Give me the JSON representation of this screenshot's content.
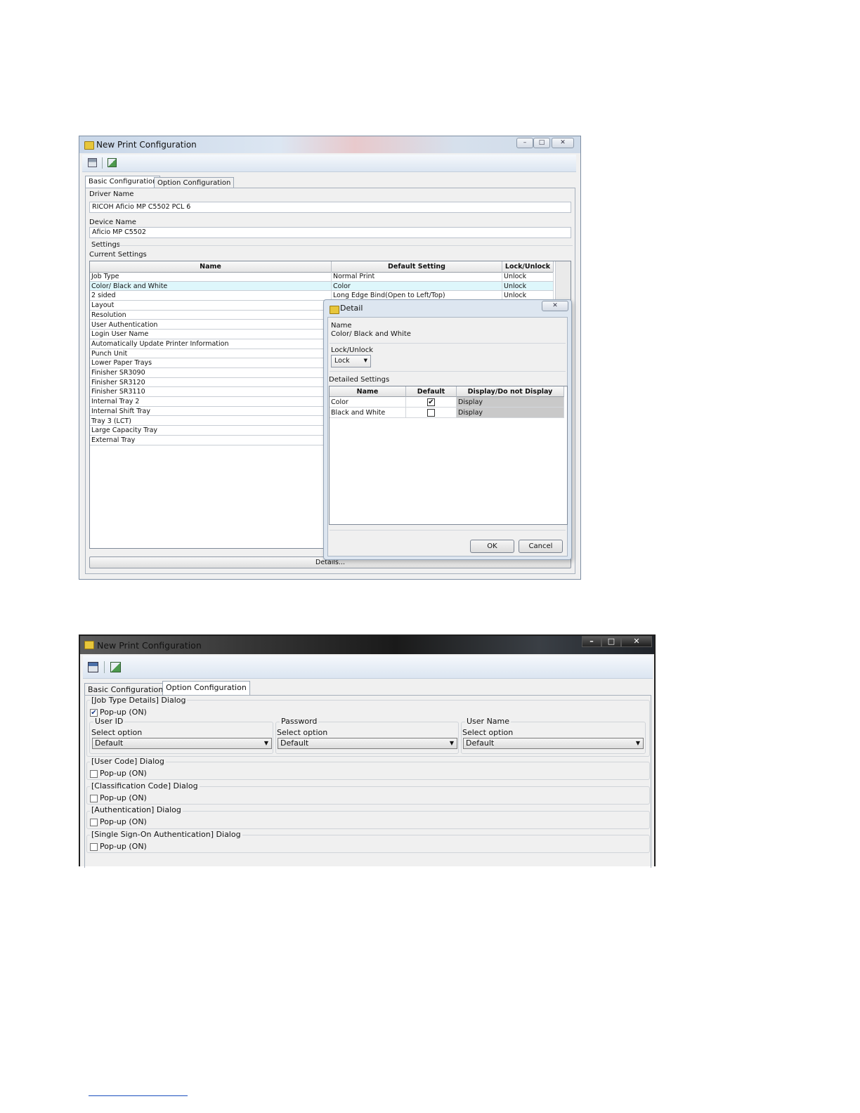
{
  "window1": {
    "title": "New Print Configuration",
    "toolbar_icons": [
      "save-icon",
      "export-icon"
    ],
    "tabs": [
      "Basic Configuration",
      "Option Configuration"
    ],
    "active_tab": "Basic Configuration",
    "driver_name_label": "Driver Name",
    "driver_name_value": "RICOH Aficio MP C5502 PCL 6",
    "device_name_label": "Device Name",
    "device_name_value": "Aficio MP C5502",
    "settings_group": "Settings",
    "current_settings_label": "Current Settings",
    "grid_columns": [
      "Name",
      "Default Setting",
      "Lock/Unlock"
    ],
    "rows": [
      {
        "name": "Job Type",
        "default": "Normal Print",
        "lock": "Unlock"
      },
      {
        "name": "Color/ Black and White",
        "default": "Color",
        "lock": "Unlock",
        "selected": true
      },
      {
        "name": "2 sided",
        "default": "Long Edge Bind(Open to Left/Top)",
        "lock": "Unlock"
      },
      {
        "name": "Layout",
        "default": "",
        "lock": ""
      },
      {
        "name": "Resolution",
        "default": "",
        "lock": ""
      },
      {
        "name": "User Authentication",
        "default": "",
        "lock": ""
      },
      {
        "name": "Login User Name",
        "default": "",
        "lock": ""
      },
      {
        "name": "Automatically Update Printer Information",
        "default": "",
        "lock": ""
      },
      {
        "name": "Punch Unit",
        "default": "",
        "lock": ""
      },
      {
        "name": "Lower Paper Trays",
        "default": "",
        "lock": ""
      },
      {
        "name": "Finisher SR3090",
        "default": "",
        "lock": ""
      },
      {
        "name": "Finisher SR3120",
        "default": "",
        "lock": ""
      },
      {
        "name": "Finisher SR3110",
        "default": "",
        "lock": ""
      },
      {
        "name": "Internal Tray 2",
        "default": "",
        "lock": ""
      },
      {
        "name": "Internal Shift Tray",
        "default": "",
        "lock": ""
      },
      {
        "name": "Tray 3 (LCT)",
        "default": "",
        "lock": ""
      },
      {
        "name": "Large Capacity Tray",
        "default": "",
        "lock": ""
      },
      {
        "name": "External Tray",
        "default": "",
        "lock": ""
      }
    ],
    "details_button": "Details..."
  },
  "detail_dialog": {
    "title": "Detail",
    "name_label": "Name",
    "name_value": "Color/ Black and White",
    "lock_label": "Lock/Unlock",
    "lock_value": "Lock",
    "detailed_settings_label": "Detailed Settings",
    "columns": [
      "Name",
      "Default",
      "Display/Do not Display"
    ],
    "rows": [
      {
        "name": "Color",
        "default_checked": true,
        "display": "Display"
      },
      {
        "name": "Black and White",
        "default_checked": false,
        "display": "Display"
      }
    ],
    "ok_button": "OK",
    "cancel_button": "Cancel",
    "close_glyph": "✕"
  },
  "window2": {
    "title": "New Print Configuration",
    "tabs": [
      "Basic Configuration",
      "Option Configuration"
    ],
    "active_tab": "Option Configuration",
    "job_type_group": "[Job Type Details] Dialog",
    "job_type_popup": {
      "label": "Pop-up (ON)",
      "checked": true
    },
    "user_id": {
      "title": "User ID",
      "select_label": "Select option",
      "value": "Default"
    },
    "password": {
      "title": "Password",
      "select_label": "Select option",
      "value": "Default"
    },
    "user_name": {
      "title": "User Name",
      "select_label": "Select option",
      "value": "Default"
    },
    "other_groups": [
      {
        "title": "[User Code] Dialog",
        "popup_label": "Pop-up (ON)",
        "checked": false
      },
      {
        "title": "[Classification Code] Dialog",
        "popup_label": "Pop-up (ON)",
        "checked": false
      },
      {
        "title": "[Authentication] Dialog",
        "popup_label": "Pop-up (ON)",
        "checked": false
      },
      {
        "title": "[Single Sign-On Authentication] Dialog",
        "popup_label": "Pop-up (ON)",
        "checked": false
      }
    ]
  },
  "colors": {
    "selected_row": "#def7fb",
    "link": "#1a4fbf"
  }
}
